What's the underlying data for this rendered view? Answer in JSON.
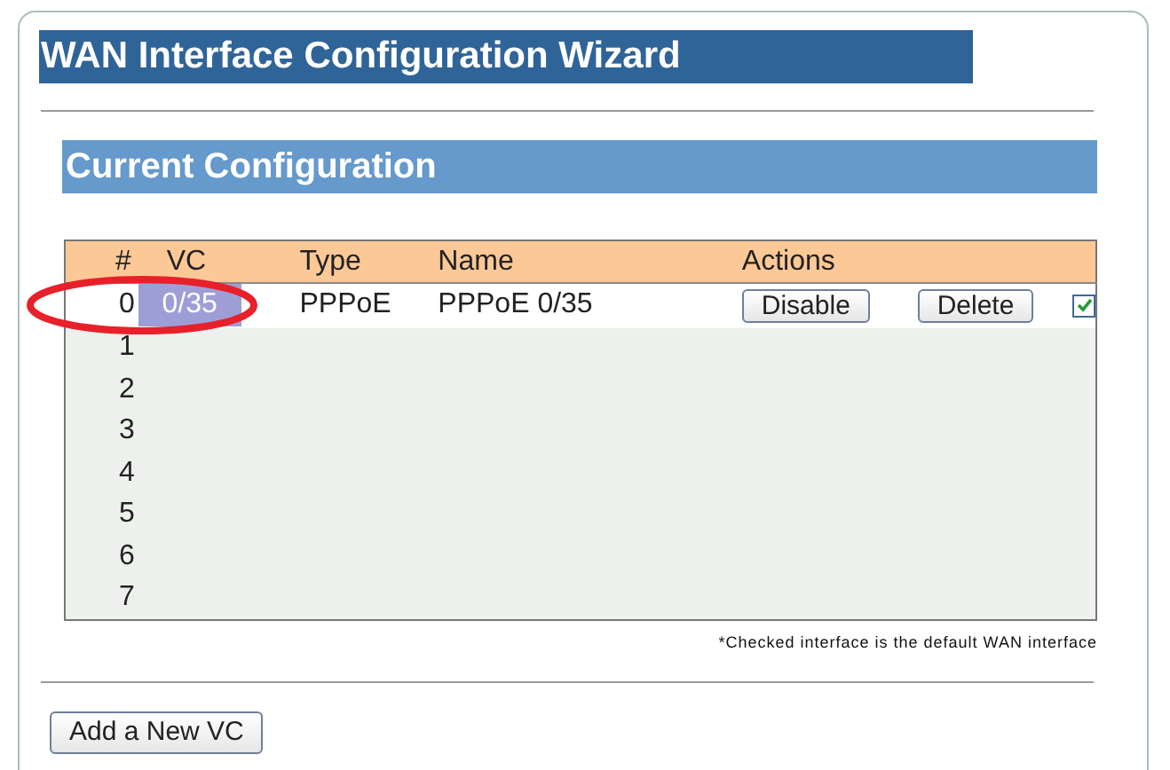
{
  "title": "WAN Interface Configuration Wizard",
  "section": {
    "title": "Current Configuration"
  },
  "table": {
    "columns": [
      "#",
      "VC",
      "Type",
      "Name",
      "Actions"
    ],
    "rows": [
      {
        "number": "0",
        "vc": "0/35",
        "vc_highlighted": true,
        "type": "PPPoE",
        "name": "PPPoE 0/35",
        "actions": [
          "Disable",
          "Delete"
        ],
        "default": true
      },
      {
        "number": "1"
      },
      {
        "number": "2"
      },
      {
        "number": "3"
      },
      {
        "number": "4"
      },
      {
        "number": "5"
      },
      {
        "number": "6"
      },
      {
        "number": "7"
      }
    ]
  },
  "note": "*Checked interface is the default WAN interface",
  "buttons": [
    "Add a New VC"
  ]
}
